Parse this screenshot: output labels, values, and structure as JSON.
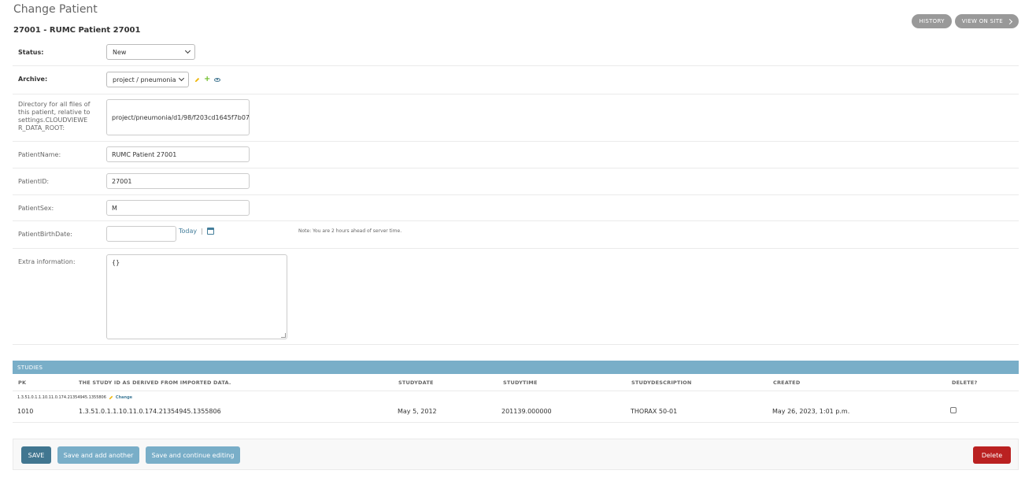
{
  "page": {
    "title": "Change Patient",
    "object_title": "27001 - RUMC Patient 27001"
  },
  "tools": {
    "history": "HISTORY",
    "view_on_site": "VIEW ON SITE"
  },
  "form": {
    "status": {
      "label": "Status:",
      "value": "New"
    },
    "archive": {
      "label": "Archive:",
      "value": "project / pneumonia"
    },
    "directory": {
      "label": "Directory for all files of this patient, relative to settings.CLOUDVIEWER_DATA_ROOT:",
      "value": "project/pneumonia/d1/98/f203cd1645f7b07"
    },
    "patient_name": {
      "label": "PatientName:",
      "value": "RUMC Patient 27001"
    },
    "patient_id": {
      "label": "PatientID:",
      "value": "27001"
    },
    "patient_sex": {
      "label": "PatientSex:",
      "value": "M"
    },
    "patient_birth_date": {
      "label": "PatientBirthDate:",
      "value": "",
      "today_link": "Today",
      "separator": "|",
      "note": "Note: You are 2 hours ahead of server time."
    },
    "extra_information": {
      "label": "Extra information:",
      "value": "{}"
    }
  },
  "studies": {
    "header": "STUDIES",
    "columns": {
      "pk": "PK",
      "study_id": "THE STUDY ID AS DERIVED FROM IMPORTED DATA.",
      "study_date": "STUDYDATE",
      "study_time": "STUDYTIME",
      "study_description": "STUDYDESCRIPTION",
      "created": "CREATED",
      "delete": "DELETE?"
    },
    "rows": [
      {
        "original_label": "1.3.51.0.1.1.10.11.0.174.21354945.1355806",
        "change_link": "Change",
        "pk": "1010",
        "study_id": "1.3.51.0.1.1.10.11.0.174.21354945.1355806",
        "study_date": "May 5, 2012",
        "study_time": "201139.000000",
        "study_description": "THORAX 50-01",
        "created": "May 26, 2023, 1:01 p.m.",
        "delete_checked": false
      }
    ]
  },
  "submit": {
    "save": "SAVE",
    "save_add_another": "Save and add another",
    "save_continue": "Save and continue editing",
    "delete": "Delete"
  },
  "colors": {
    "primary": "#417690",
    "secondary": "#79aec8",
    "danger": "#ba2121",
    "link": "#447e9b"
  }
}
